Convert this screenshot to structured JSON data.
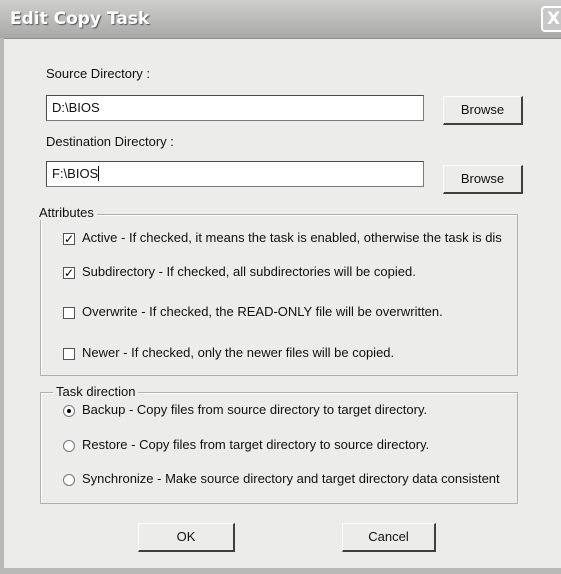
{
  "window": {
    "title": "Edit Copy Task",
    "close_symbol": "X"
  },
  "source": {
    "label": "Source Directory :",
    "value": "D:\\BIOS",
    "browse_label": "Browse"
  },
  "destination": {
    "label": "Destination Directory :",
    "value": "F:\\BIOS",
    "browse_label": "Browse"
  },
  "attributes": {
    "legend": "Attributes",
    "items": [
      {
        "label": "Active - If checked, it means the task is enabled, otherwise the task is dis",
        "checked": true
      },
      {
        "label": "Subdirectory - If checked, all subdirectories will be copied.",
        "checked": true
      },
      {
        "label": "Overwrite - If checked, the READ-ONLY file will be overwritten.",
        "checked": false
      },
      {
        "label": "Newer - If checked, only the newer files will be copied.",
        "checked": false
      }
    ]
  },
  "task_direction": {
    "legend": "Task direction",
    "items": [
      {
        "label": "Backup - Copy files from source directory to target directory.",
        "selected": true
      },
      {
        "label": "Restore - Copy files from target directory to source directory.",
        "selected": false
      },
      {
        "label": "Synchronize - Make source directory and target directory data consistent",
        "selected": false
      }
    ]
  },
  "buttons": {
    "ok": "OK",
    "cancel": "Cancel"
  },
  "check_mark": "✓"
}
